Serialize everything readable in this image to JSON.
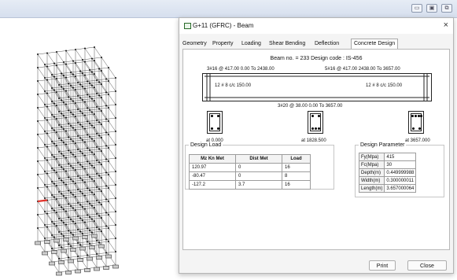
{
  "window": {
    "min_glyph": "▭",
    "max_glyph": "▣",
    "close_glyph": "⧉"
  },
  "dialog": {
    "title": "G+11 (GFRC) - Beam",
    "close_glyph": "×",
    "tabs": [
      {
        "label": "Geometry"
      },
      {
        "label": "Property"
      },
      {
        "label": "Loading"
      },
      {
        "label": "Shear Bending"
      },
      {
        "label": "Deflection"
      },
      {
        "label": "Concrete Design",
        "active": true
      }
    ],
    "beam_info": "Beam no. = 233  Design code : IS-456",
    "top_left_bars": "3#16 @ 417.00 0.00 To 2438.00",
    "top_right_bars": "5#16 @ 417.00 2438.00 To 3657.00",
    "stirrups_left": "12 # 8 c/c 150.00",
    "stirrups_right": "12 # 8 c/c 150.00",
    "bottom_bars": "3#20 @ 38.00 0.00 To 3657.00",
    "sections": [
      {
        "label": "at 0.000"
      },
      {
        "label": "at 1828.500"
      },
      {
        "label": "at 3657.000"
      }
    ],
    "design_load": {
      "title": "Design Load",
      "headers": [
        "Mz Kn Met",
        "Dist Met",
        "Load"
      ],
      "rows": [
        [
          "120.97",
          "0",
          "16"
        ],
        [
          "-80.47",
          "0",
          "8"
        ],
        [
          "-127.2",
          "3.7",
          "16"
        ]
      ]
    },
    "design_parameter": {
      "title": "Design Parameter",
      "rows": [
        {
          "key": "Fy(Mpa)",
          "value": "415"
        },
        {
          "key": "Fc(Mpa)",
          "value": "30"
        },
        {
          "key": "Depth(m)",
          "value": "0.449999988"
        },
        {
          "key": "Width(m)",
          "value": "0.300000011"
        },
        {
          "key": "Length(m)",
          "value": "3.657000064"
        }
      ]
    },
    "buttons": {
      "print": "Print",
      "close": "Close"
    },
    "colors": {
      "highlight_member": "#e0332b",
      "frame": "#555555"
    }
  }
}
